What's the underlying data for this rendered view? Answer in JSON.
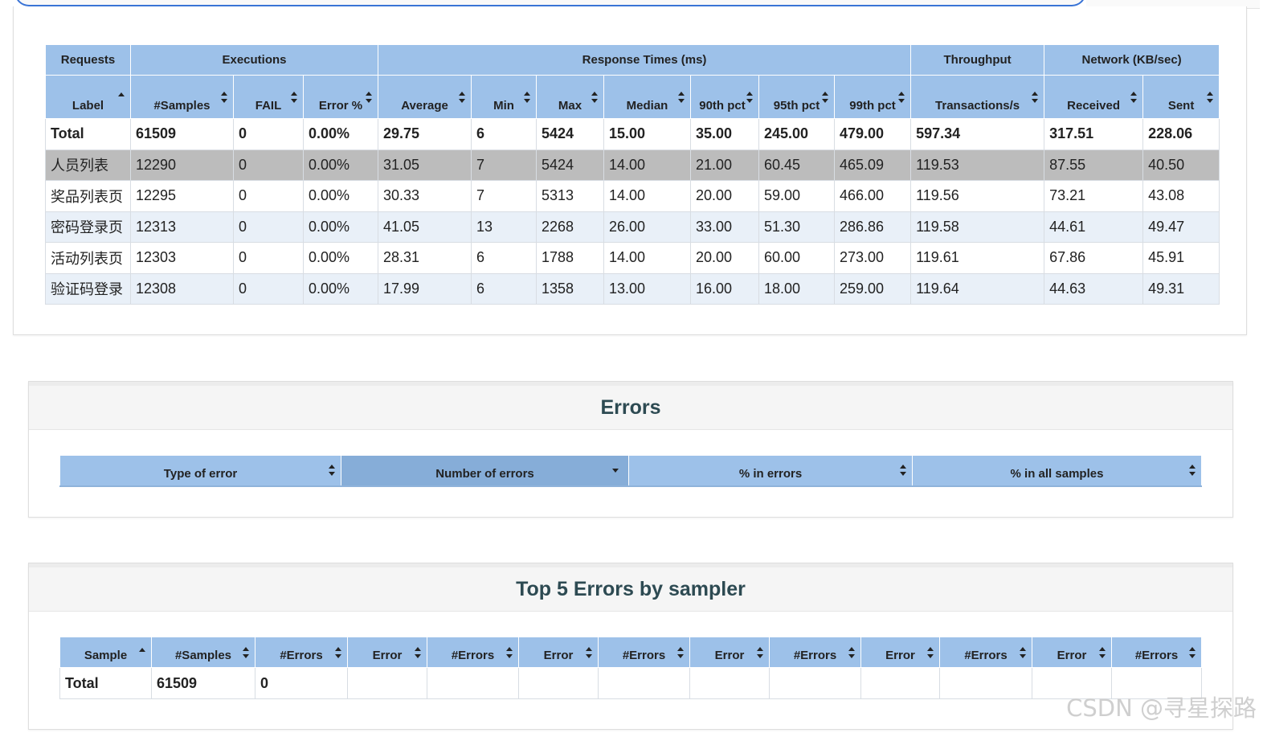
{
  "statistics": {
    "groups": [
      "Requests",
      "Executions",
      "Response Times (ms)",
      "Throughput",
      "Network (KB/sec)"
    ],
    "columns": [
      "Label",
      "#Samples",
      "FAIL",
      "Error %",
      "Average",
      "Min",
      "Max",
      "Median",
      "90th pct",
      "95th pct",
      "99th pct",
      "Transactions/s",
      "Received",
      "Sent"
    ],
    "total": [
      "Total",
      "61509",
      "0",
      "0.00%",
      "29.75",
      "6",
      "5424",
      "15.00",
      "35.00",
      "245.00",
      "479.00",
      "597.34",
      "317.51",
      "228.06"
    ],
    "rows": [
      [
        "人员列表",
        "12290",
        "0",
        "0.00%",
        "31.05",
        "7",
        "5424",
        "14.00",
        "21.00",
        "60.45",
        "465.09",
        "119.53",
        "87.55",
        "40.50"
      ],
      [
        "奖品列表页",
        "12295",
        "0",
        "0.00%",
        "30.33",
        "7",
        "5313",
        "14.00",
        "20.00",
        "59.00",
        "466.00",
        "119.56",
        "73.21",
        "43.08"
      ],
      [
        "密码登录页",
        "12313",
        "0",
        "0.00%",
        "41.05",
        "13",
        "2268",
        "26.00",
        "33.00",
        "51.30",
        "286.86",
        "119.58",
        "44.61",
        "49.47"
      ],
      [
        "活动列表页",
        "12303",
        "0",
        "0.00%",
        "28.31",
        "6",
        "1788",
        "14.00",
        "20.00",
        "60.00",
        "273.00",
        "119.61",
        "67.86",
        "45.91"
      ],
      [
        "验证码登录",
        "12308",
        "0",
        "0.00%",
        "17.99",
        "6",
        "1358",
        "13.00",
        "16.00",
        "18.00",
        "259.00",
        "119.64",
        "44.63",
        "49.31"
      ]
    ]
  },
  "errors": {
    "title": "Errors",
    "columns": [
      "Type of error",
      "Number of errors",
      "% in errors",
      "% in all samples"
    ]
  },
  "top5": {
    "title": "Top 5 Errors by sampler",
    "columns": [
      "Sample",
      "#Samples",
      "#Errors",
      "Error",
      "#Errors",
      "Error",
      "#Errors",
      "Error",
      "#Errors",
      "Error",
      "#Errors",
      "Error",
      "#Errors"
    ],
    "total": [
      "Total",
      "61509",
      "0",
      "",
      "",
      "",
      "",
      "",
      "",
      "",
      "",
      "",
      ""
    ]
  },
  "watermark": "CSDN @寻星探路",
  "colors": {
    "header_blue": "#9dc1e9",
    "row_gray": "#bcbcbc",
    "row_alt": "#e9f0f8",
    "section_title": "#2d4a52"
  }
}
